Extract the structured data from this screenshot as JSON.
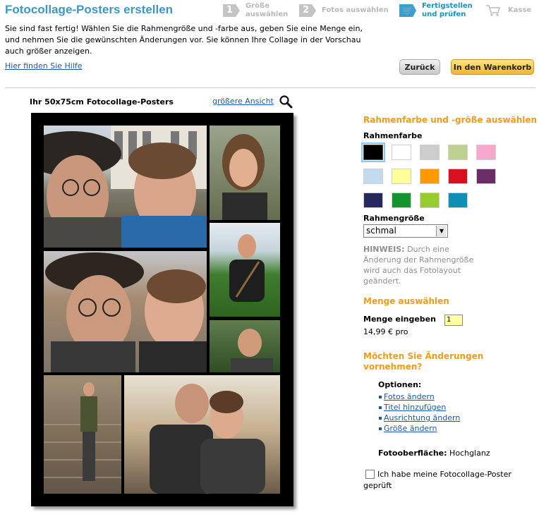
{
  "page": {
    "title": "Fotocollage-Posters erstellen",
    "intro": "Sie sind fast fertig! Wählen Sie die Rahmengröße und -farbe aus, geben Sie eine Menge ein, und nehmen Sie die gewünschten Änderungen vor. Sie können Ihre Collage in der Vorschau auch größer anzeigen.",
    "help_link": "Hier finden Sie Hilfe"
  },
  "steps": [
    {
      "num": "1",
      "label_line1": "Größe",
      "label_line2": "auswählen",
      "state": "done"
    },
    {
      "num": "2",
      "label_line1": "Fotos auswählen",
      "label_line2": "",
      "state": "done"
    },
    {
      "num": "",
      "label_line1": "Fertigstellen",
      "label_line2": "und prüfen",
      "state": "active",
      "icon": "cart-icon"
    },
    {
      "num": "",
      "label_line1": "Kasse",
      "label_line2": "",
      "state": "upcoming",
      "icon": "cart-icon"
    }
  ],
  "buttons": {
    "back": "Zurück",
    "add_to_cart": "In den Warenkorb"
  },
  "preview": {
    "title": "Ihr 50x75cm Fotocollage-Posters",
    "larger_view": "größere Ansicht"
  },
  "options_panel": {
    "frame_heading": "Rahmenfarbe und -größe auswählen",
    "frame_color_label": "Rahmenfarbe",
    "colors": [
      "#000000",
      "#ffffff",
      "#cccccc",
      "#bcd08f",
      "#f8a8cf",
      "#c3dbef",
      "#ffff99",
      "#ff9a00",
      "#d81020",
      "#6a2c64",
      "#26285e",
      "#15932f",
      "#98cc2e",
      "#0f8fb5"
    ],
    "selected_color": "#000000",
    "frame_size_label": "Rahmengröße",
    "frame_size_value": "schmal",
    "hint_label": "HINWEIS:",
    "hint_text": "Durch eine Änderung der Rahmengröße wird auch das Fotolayout geändert.",
    "quantity_heading": "Menge auswählen",
    "quantity_label": "Menge eingeben",
    "quantity_value": "1",
    "price": "14,99 € pro",
    "changes_heading_line1": "Möchten Sie Änderungen",
    "changes_heading_line2": "vornehmen?",
    "options_label": "Optionen:",
    "options": [
      "Fotos ändern",
      "Titel hinzufügen",
      "Ausrichtung ändern",
      "Größe ändern"
    ],
    "surface_label": "Fotooberfläche:",
    "surface_value": "Hochglanz",
    "confirm_label": "Ich habe meine Fotocollage-Poster geprüft"
  }
}
